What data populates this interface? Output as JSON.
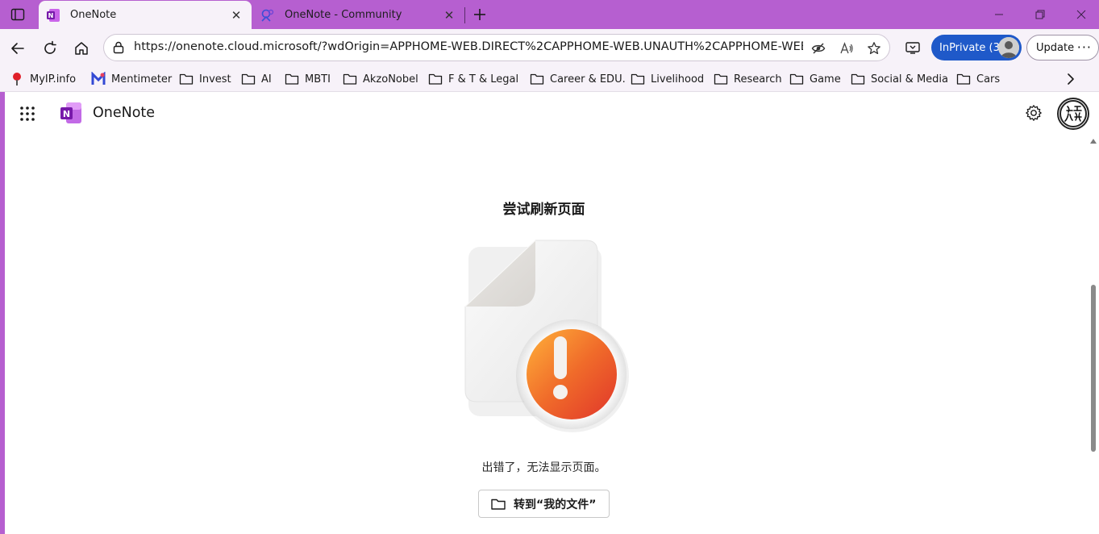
{
  "browser": {
    "tabs": [
      {
        "title": "OneNote",
        "active": true,
        "favicon": "onenote-icon"
      },
      {
        "title": "OneNote - Community",
        "active": false,
        "favicon": "community-icon"
      }
    ],
    "url": "https://onenote.cloud.microsoft/?wdOrigin=APPHOME-WEB.DIRECT%2CAPPHOME-WEB.UNAUTH%2CAPPHOME-WEB.S...",
    "inprivate_label": "InPrivate (3)",
    "update_label": "Update",
    "more_label": "···",
    "accent_color": "#b65fd0",
    "bookmarks": [
      {
        "label": "MyIP.info",
        "icon": "pin-icon"
      },
      {
        "label": "Mentimeter",
        "icon": "mentimeter-icon"
      },
      {
        "label": "Invest",
        "icon": "folder-icon"
      },
      {
        "label": "AI",
        "icon": "folder-icon"
      },
      {
        "label": "MBTI",
        "icon": "folder-icon"
      },
      {
        "label": "AkzoNobel",
        "icon": "folder-icon"
      },
      {
        "label": "F & T & Legal",
        "icon": "folder-icon"
      },
      {
        "label": "Career & EDU.",
        "icon": "folder-icon"
      },
      {
        "label": "Livelihood",
        "icon": "folder-icon"
      },
      {
        "label": "Research",
        "icon": "folder-icon"
      },
      {
        "label": "Game",
        "icon": "folder-icon"
      },
      {
        "label": "Social & Media",
        "icon": "folder-icon"
      },
      {
        "label": "Cars",
        "icon": "folder-icon"
      }
    ]
  },
  "app": {
    "name": "OneNote",
    "brand_color": "#7719aa"
  },
  "error": {
    "title": "尝试刷新页面",
    "message": "出错了，无法显示页面。",
    "button_label": "转到“我的文件”"
  }
}
